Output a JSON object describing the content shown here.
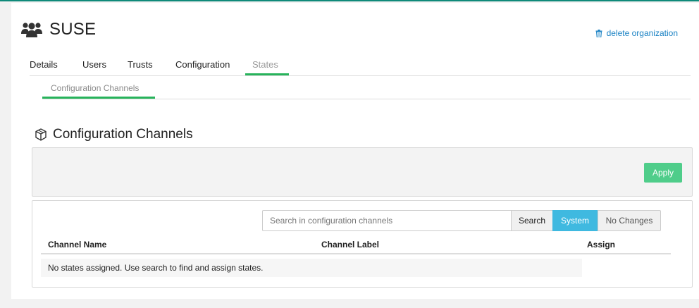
{
  "org": {
    "title": "SUSE",
    "icon": "users-icon",
    "delete_label": "delete organization",
    "delete_icon": "trash-icon"
  },
  "tabs": [
    {
      "label": "Details"
    },
    {
      "label": "Users"
    },
    {
      "label": "Trusts"
    },
    {
      "label": "Configuration"
    },
    {
      "label": "States",
      "active": true
    }
  ],
  "subtabs": [
    {
      "label": "Configuration Channels",
      "active": true
    }
  ],
  "section": {
    "title": "Configuration Channels",
    "icon": "cube-icon"
  },
  "toolbar": {
    "apply_label": "Apply"
  },
  "search": {
    "placeholder": "Search in configuration channels",
    "value": "",
    "search_label": "Search",
    "system_label": "System",
    "no_changes_label": "No Changes"
  },
  "table": {
    "columns": [
      "Channel Name",
      "Channel Label",
      "Assign"
    ],
    "empty_message": "No states assigned. Use search to find and assign states."
  },
  "colors": {
    "accent_green": "#27b35b",
    "apply_green": "#4fcd8a",
    "link_blue": "#1a82c4",
    "system_blue": "#3fb9e0",
    "top_line": "#0f8a7a"
  }
}
